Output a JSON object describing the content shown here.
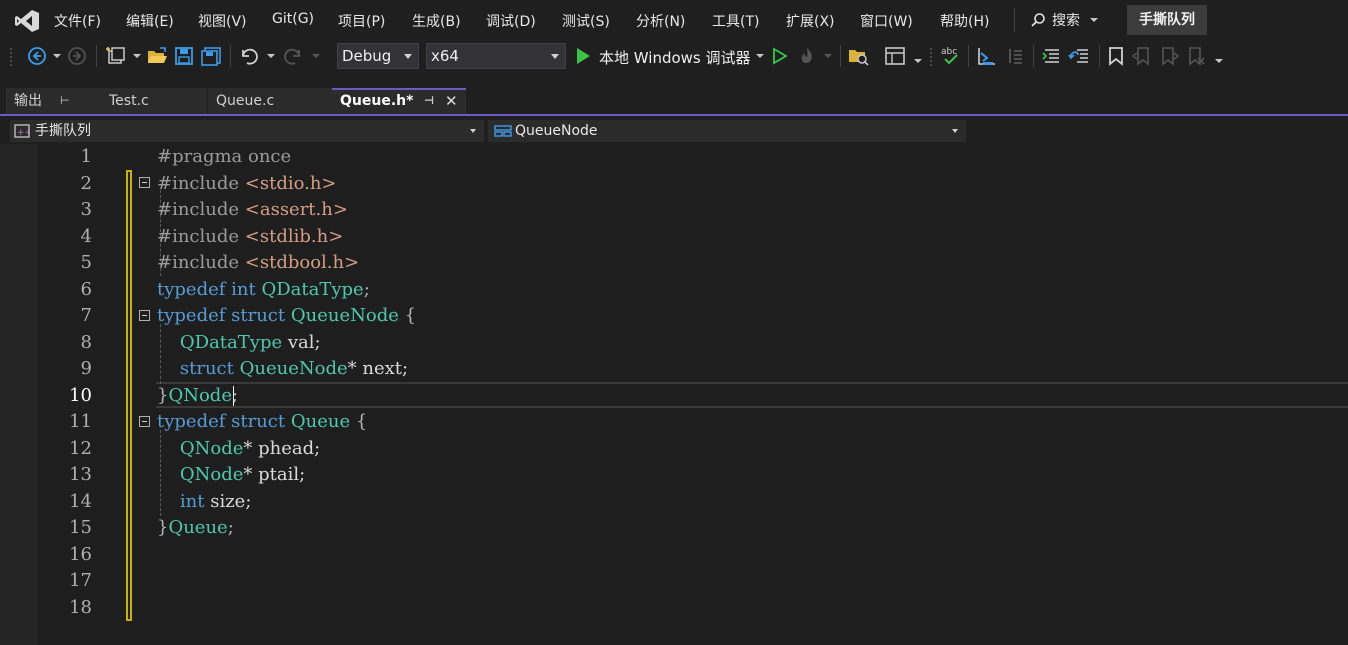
{
  "menu": {
    "file": "文件(F)",
    "edit": "编辑(E)",
    "view": "视图(V)",
    "git": "Git(G)",
    "project": "项目(P)",
    "build": "生成(B)",
    "debug": "调试(D)",
    "test": "测试(S)",
    "analyze": "分析(N)",
    "tools": "工具(T)",
    "extensions": "扩展(X)",
    "window": "窗口(W)",
    "help": "帮助(H)"
  },
  "search": {
    "label": "搜索"
  },
  "solution_name": "手撕队列",
  "toolbar": {
    "configuration": "Debug",
    "platform": "x64",
    "run_label": "本地 Windows 调试器"
  },
  "tabs": {
    "output": "输出",
    "test_c": "Test.c",
    "queue_c": "Queue.c",
    "queue_h": "Queue.h*"
  },
  "navbar": {
    "project_scope": "手撕队列",
    "member_scope": "QueueNode"
  },
  "editor": {
    "current_line": 10,
    "lines": [
      {
        "num": "1",
        "tokens": [
          {
            "t": "#pragma once",
            "c": "pp"
          }
        ]
      },
      {
        "num": "2",
        "tokens": [
          {
            "t": "#include ",
            "c": "pp"
          },
          {
            "t": "<stdio.h>",
            "c": "str"
          }
        ]
      },
      {
        "num": "3",
        "tokens": [
          {
            "t": "#include ",
            "c": "pp"
          },
          {
            "t": "<assert.h>",
            "c": "str"
          }
        ]
      },
      {
        "num": "4",
        "tokens": [
          {
            "t": "#include ",
            "c": "pp"
          },
          {
            "t": "<stdlib.h>",
            "c": "str"
          }
        ]
      },
      {
        "num": "5",
        "tokens": [
          {
            "t": "#include ",
            "c": "pp"
          },
          {
            "t": "<stdbool.h>",
            "c": "str"
          }
        ]
      },
      {
        "num": "6",
        "tokens": [
          {
            "t": "typedef ",
            "c": "kw"
          },
          {
            "t": "int ",
            "c": "kw"
          },
          {
            "t": "QDataType",
            "c": "ty"
          },
          {
            "t": ";",
            "c": "pu"
          }
        ]
      },
      {
        "num": "7",
        "tokens": [
          {
            "t": "typedef ",
            "c": "kw"
          },
          {
            "t": "struct ",
            "c": "kw"
          },
          {
            "t": "QueueNode",
            "c": "ty"
          },
          {
            "t": " {",
            "c": "pu"
          }
        ]
      },
      {
        "num": "8",
        "tokens": [
          {
            "t": "    ",
            "c": "id"
          },
          {
            "t": "QDataType",
            "c": "ty"
          },
          {
            "t": " val;",
            "c": "id"
          }
        ]
      },
      {
        "num": "9",
        "tokens": [
          {
            "t": "    ",
            "c": "id"
          },
          {
            "t": "struct ",
            "c": "kw"
          },
          {
            "t": "QueueNode",
            "c": "ty"
          },
          {
            "t": "* next;",
            "c": "id"
          }
        ]
      },
      {
        "num": "10",
        "tokens": [
          {
            "t": "}",
            "c": "pu"
          },
          {
            "t": "QNode",
            "c": "ty"
          },
          {
            "t": ";",
            "c": "pu"
          }
        ]
      },
      {
        "num": "11",
        "tokens": [
          {
            "t": "typedef ",
            "c": "kw"
          },
          {
            "t": "struct ",
            "c": "kw"
          },
          {
            "t": "Queue",
            "c": "ty"
          },
          {
            "t": " {",
            "c": "pu"
          }
        ]
      },
      {
        "num": "12",
        "tokens": [
          {
            "t": "    ",
            "c": "id"
          },
          {
            "t": "QNode",
            "c": "ty"
          },
          {
            "t": "* phead;",
            "c": "id"
          }
        ]
      },
      {
        "num": "13",
        "tokens": [
          {
            "t": "    ",
            "c": "id"
          },
          {
            "t": "QNode",
            "c": "ty"
          },
          {
            "t": "* ptail;",
            "c": "id"
          }
        ]
      },
      {
        "num": "14",
        "tokens": [
          {
            "t": "    ",
            "c": "id"
          },
          {
            "t": "int ",
            "c": "kw"
          },
          {
            "t": "size;",
            "c": "id"
          }
        ]
      },
      {
        "num": "15",
        "tokens": [
          {
            "t": "}",
            "c": "pu"
          },
          {
            "t": "Queue",
            "c": "ty"
          },
          {
            "t": ";",
            "c": "pu"
          }
        ]
      },
      {
        "num": "16",
        "tokens": []
      },
      {
        "num": "17",
        "tokens": []
      },
      {
        "num": "18",
        "tokens": []
      }
    ]
  },
  "colors": {
    "accent": "#6a5acd",
    "keyword": "#569cd6",
    "type": "#4ec9b0",
    "string": "#d69d85",
    "preprocessor": "#9b9b9b",
    "modified_marker": "#c8b400"
  }
}
